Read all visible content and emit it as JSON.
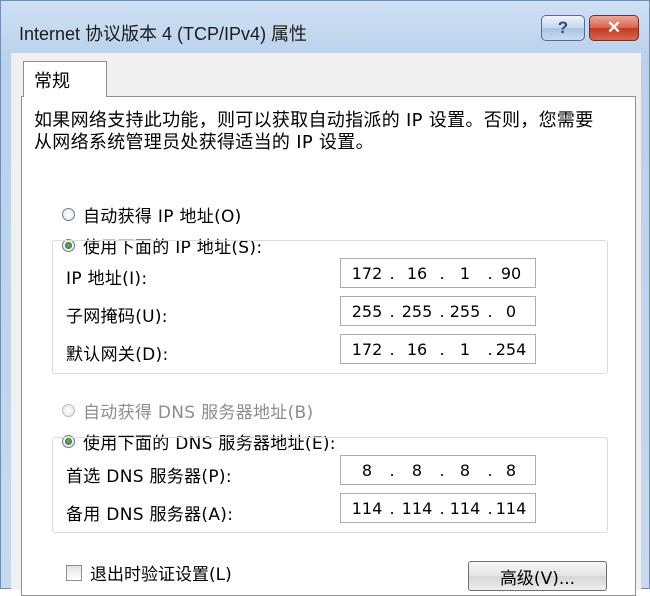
{
  "window": {
    "title": "Internet 协议版本 4 (TCP/IPv4) 属性",
    "help_label": "?",
    "close_label": "✕"
  },
  "tab": {
    "label": "常规"
  },
  "description": "如果网络支持此功能，则可以获取自动指派的 IP 设置。否则，您需要从网络系统管理员处获得适当的 IP 设置。",
  "ip_section": {
    "auto_option": "自动获得 IP 地址(O)",
    "manual_option": "使用下面的 IP 地址(S):",
    "selected": "manual",
    "fields": [
      {
        "label": "IP 地址(I):",
        "octets": [
          "172",
          "16",
          "1",
          "90"
        ]
      },
      {
        "label": "子网掩码(U):",
        "octets": [
          "255",
          "255",
          "255",
          "0"
        ]
      },
      {
        "label": "默认网关(D):",
        "octets": [
          "172",
          "16",
          "1",
          "254"
        ]
      }
    ]
  },
  "dns_section": {
    "auto_option": "自动获得 DNS 服务器地址(B)",
    "manual_option": "使用下面的 DNS 服务器地址(E):",
    "selected": "manual",
    "fields": [
      {
        "label": "首选 DNS 服务器(P):",
        "octets": [
          "8",
          "8",
          "8",
          "8"
        ]
      },
      {
        "label": "备用 DNS 服务器(A):",
        "octets": [
          "114",
          "114",
          "114",
          "114"
        ]
      }
    ]
  },
  "validate_checkbox": {
    "label": "退出时验证设置(L)",
    "checked": false
  },
  "advanced_button": {
    "label": "高级(V)..."
  },
  "colors": {
    "title_gradient": "#b9d1ec",
    "close_button": "#c23b22",
    "radio_selected": "#1f6b1f"
  }
}
